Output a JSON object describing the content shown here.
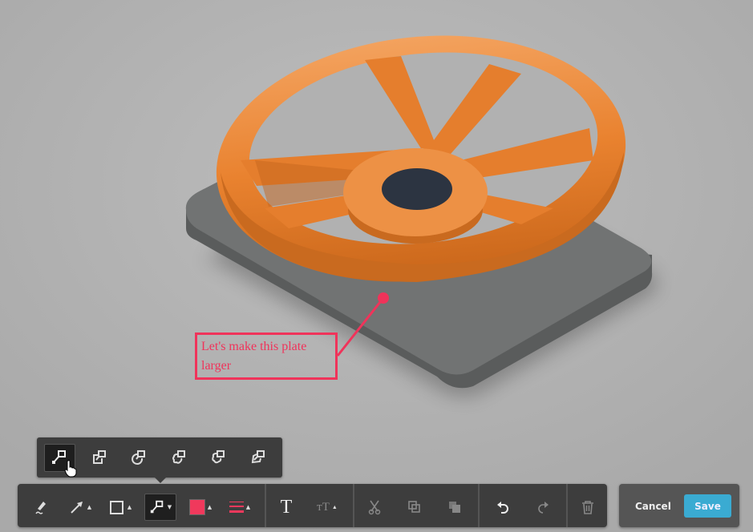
{
  "annotation": {
    "text_line1": "Let's make this plate",
    "text_line2": "larger",
    "color": "#f0335a"
  },
  "popup": {
    "items": [
      {
        "name": "callout-straight",
        "selected": true
      },
      {
        "name": "callout-box"
      },
      {
        "name": "callout-circle"
      },
      {
        "name": "callout-cloud"
      },
      {
        "name": "callout-cloud-alt"
      },
      {
        "name": "callout-freeform"
      }
    ]
  },
  "toolbar": {
    "text_icon": "T",
    "text_size_icon": "ᴛT",
    "color_swatch": "#f0395c"
  },
  "actions": {
    "cancel_label": "Cancel",
    "save_label": "Save",
    "save_color": "#3aabd2"
  }
}
